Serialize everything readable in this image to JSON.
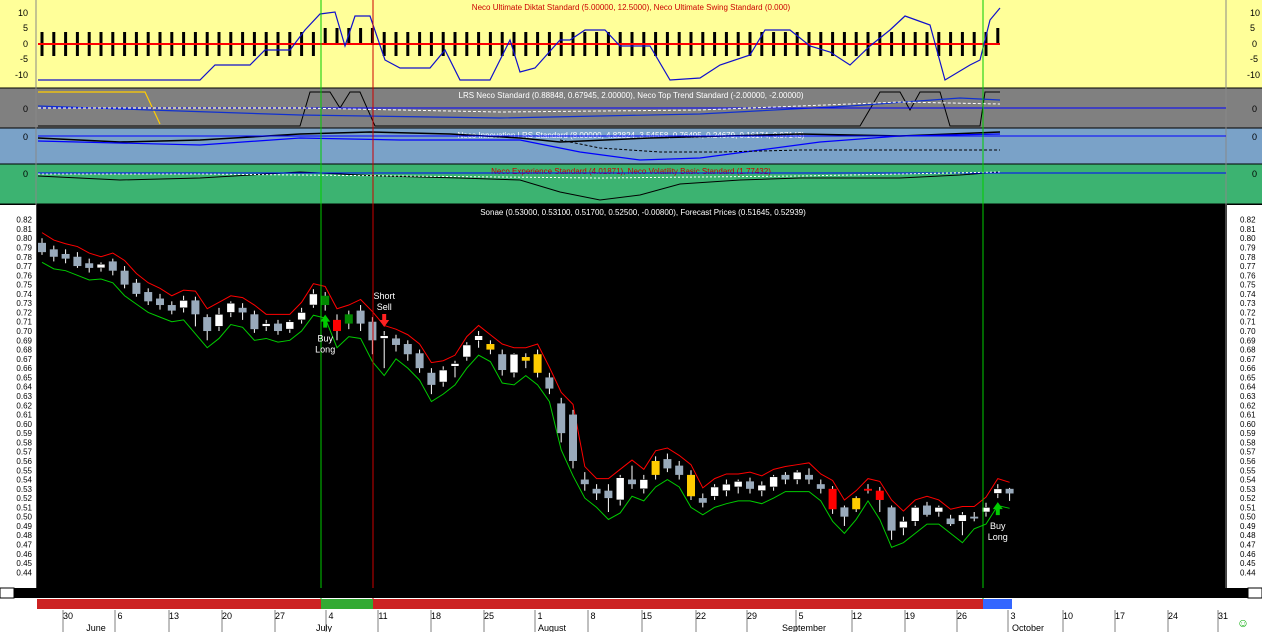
{
  "chart_data": {
    "type": "candlestick",
    "title": "Sonae (0.53000, 0.53100, 0.51700, 0.52500, -0.00800), Forecast Prices (0.51645, 0.52939)",
    "panels": [
      {
        "id": "diktat",
        "title": "Neco Ultimate Diktat Standard (5.00000, 12.5000), Neco Ultimate Swing Standard (0.000)",
        "ticks": [
          "10",
          "5",
          "0",
          "-5",
          "-10"
        ],
        "background": "#ffff99"
      },
      {
        "id": "lrs",
        "title": "LRS Neco Standard (0.88848, 0.67945, 2.00000), Neco Top Trend Standard (-2.00000, -2.00000)",
        "ticks": [
          "0"
        ],
        "background": "#808080"
      },
      {
        "id": "innovation",
        "title": "Neco Innovation LRS Standard (8.00000, 4.82824, 3.54558, 0.76495, 0.24679, 0.16174, 0.97143)",
        "ticks": [
          "0"
        ],
        "background": "#7aa2c8"
      },
      {
        "id": "experience",
        "title": "Neco Experience Standard (4.01871), Neco Volatility Basic Standard (1.77432)",
        "ticks": [
          "0"
        ],
        "background": "#3cb371"
      }
    ],
    "price_axis": {
      "ylim": [
        0.435,
        0.825
      ],
      "ticks": [
        "0.82",
        "0.81",
        "0.80",
        "0.79",
        "0.78",
        "0.77",
        "0.76",
        "0.75",
        "0.74",
        "0.73",
        "0.72",
        "0.71",
        "0.70",
        "0.69",
        "0.68",
        "0.67",
        "0.66",
        "0.65",
        "0.64",
        "0.63",
        "0.62",
        "0.61",
        "0.60",
        "0.59",
        "0.58",
        "0.57",
        "0.56",
        "0.55",
        "0.54",
        "0.53",
        "0.52",
        "0.51",
        "0.50",
        "0.49",
        "0.48",
        "0.47",
        "0.46",
        "0.45",
        "0.44"
      ]
    },
    "x_axis": {
      "day_ticks": [
        "30",
        "6",
        "13",
        "20",
        "27",
        "4",
        "11",
        "18",
        "25",
        "1",
        "8",
        "15",
        "22",
        "29",
        "5",
        "12",
        "19",
        "26",
        "3",
        "10",
        "17",
        "24",
        "31"
      ],
      "months": [
        "June",
        "July",
        "August",
        "September",
        "October"
      ]
    },
    "candles": [
      {
        "o": 0.795,
        "h": 0.8,
        "c": 0.785,
        "l": 0.782
      },
      {
        "o": 0.788,
        "h": 0.792,
        "c": 0.78,
        "l": 0.775
      },
      {
        "o": 0.783,
        "h": 0.788,
        "c": 0.778,
        "l": 0.773
      },
      {
        "o": 0.78,
        "h": 0.785,
        "c": 0.77,
        "l": 0.768
      },
      {
        "o": 0.773,
        "h": 0.778,
        "c": 0.768,
        "l": 0.763
      },
      {
        "o": 0.768,
        "h": 0.774,
        "c": 0.772,
        "l": 0.764
      },
      {
        "o": 0.775,
        "h": 0.778,
        "c": 0.765,
        "l": 0.76
      },
      {
        "o": 0.765,
        "h": 0.77,
        "c": 0.75,
        "l": 0.746
      },
      {
        "o": 0.752,
        "h": 0.756,
        "c": 0.74,
        "l": 0.737
      },
      {
        "o": 0.742,
        "h": 0.746,
        "c": 0.732,
        "l": 0.728
      },
      {
        "o": 0.735,
        "h": 0.74,
        "c": 0.728,
        "l": 0.723
      },
      {
        "o": 0.728,
        "h": 0.732,
        "c": 0.722,
        "l": 0.718
      },
      {
        "o": 0.725,
        "h": 0.738,
        "c": 0.733,
        "l": 0.72
      },
      {
        "o": 0.733,
        "h": 0.737,
        "c": 0.718,
        "l": 0.705
      },
      {
        "o": 0.715,
        "h": 0.718,
        "c": 0.7,
        "l": 0.69
      },
      {
        "o": 0.705,
        "h": 0.725,
        "c": 0.718,
        "l": 0.7
      },
      {
        "o": 0.72,
        "h": 0.732,
        "c": 0.73,
        "l": 0.715
      },
      {
        "o": 0.725,
        "h": 0.73,
        "c": 0.72,
        "l": 0.712
      },
      {
        "o": 0.718,
        "h": 0.722,
        "c": 0.702,
        "l": 0.698
      },
      {
        "o": 0.705,
        "h": 0.712,
        "c": 0.708,
        "l": 0.7
      },
      {
        "o": 0.708,
        "h": 0.712,
        "c": 0.7,
        "l": 0.696
      },
      {
        "o": 0.702,
        "h": 0.712,
        "c": 0.71,
        "l": 0.698
      },
      {
        "o": 0.712,
        "h": 0.725,
        "c": 0.72,
        "l": 0.708
      },
      {
        "o": 0.728,
        "h": 0.745,
        "c": 0.74,
        "l": 0.725
      },
      {
        "o": 0.738,
        "h": 0.742,
        "c": 0.728,
        "l": 0.722
      },
      {
        "o": 0.712,
        "h": 0.718,
        "c": 0.7,
        "l": 0.69
      },
      {
        "o": 0.708,
        "h": 0.722,
        "c": 0.718,
        "l": 0.702
      },
      {
        "o": 0.722,
        "h": 0.728,
        "c": 0.708,
        "l": 0.7
      },
      {
        "o": 0.71,
        "h": 0.715,
        "c": 0.69,
        "l": 0.675
      },
      {
        "o": 0.692,
        "h": 0.7,
        "c": 0.695,
        "l": 0.66
      },
      {
        "o": 0.692,
        "h": 0.696,
        "c": 0.685,
        "l": 0.678
      },
      {
        "o": 0.686,
        "h": 0.69,
        "c": 0.675,
        "l": 0.668
      },
      {
        "o": 0.676,
        "h": 0.68,
        "c": 0.66,
        "l": 0.655
      },
      {
        "o": 0.655,
        "h": 0.66,
        "c": 0.642,
        "l": 0.632
      },
      {
        "o": 0.645,
        "h": 0.662,
        "c": 0.658,
        "l": 0.64
      },
      {
        "o": 0.662,
        "h": 0.668,
        "c": 0.665,
        "l": 0.65
      },
      {
        "o": 0.672,
        "h": 0.688,
        "c": 0.685,
        "l": 0.668
      },
      {
        "o": 0.69,
        "h": 0.7,
        "c": 0.695,
        "l": 0.682
      },
      {
        "o": 0.686,
        "h": 0.69,
        "c": 0.68,
        "l": 0.675
      },
      {
        "o": 0.675,
        "h": 0.68,
        "c": 0.658,
        "l": 0.652
      },
      {
        "o": 0.655,
        "h": 0.676,
        "c": 0.675,
        "l": 0.65
      },
      {
        "o": 0.672,
        "h": 0.676,
        "c": 0.668,
        "l": 0.66
      },
      {
        "o": 0.675,
        "h": 0.68,
        "c": 0.655,
        "l": 0.65
      },
      {
        "o": 0.65,
        "h": 0.655,
        "c": 0.638,
        "l": 0.632
      },
      {
        "o": 0.622,
        "h": 0.628,
        "c": 0.59,
        "l": 0.58
      },
      {
        "o": 0.61,
        "h": 0.615,
        "c": 0.56,
        "l": 0.552
      },
      {
        "o": 0.54,
        "h": 0.548,
        "c": 0.535,
        "l": 0.528
      },
      {
        "o": 0.53,
        "h": 0.535,
        "c": 0.525,
        "l": 0.518
      },
      {
        "o": 0.528,
        "h": 0.535,
        "c": 0.52,
        "l": 0.505
      },
      {
        "o": 0.518,
        "h": 0.545,
        "c": 0.542,
        "l": 0.512
      },
      {
        "o": 0.54,
        "h": 0.555,
        "c": 0.535,
        "l": 0.53
      },
      {
        "o": 0.53,
        "h": 0.545,
        "c": 0.54,
        "l": 0.525
      },
      {
        "o": 0.545,
        "h": 0.565,
        "c": 0.56,
        "l": 0.54
      },
      {
        "o": 0.562,
        "h": 0.568,
        "c": 0.552,
        "l": 0.548
      },
      {
        "o": 0.555,
        "h": 0.56,
        "c": 0.545,
        "l": 0.54
      },
      {
        "o": 0.545,
        "h": 0.55,
        "c": 0.522,
        "l": 0.518
      },
      {
        "o": 0.52,
        "h": 0.525,
        "c": 0.515,
        "l": 0.51
      },
      {
        "o": 0.522,
        "h": 0.535,
        "c": 0.532,
        "l": 0.518
      },
      {
        "o": 0.528,
        "h": 0.54,
        "c": 0.535,
        "l": 0.522
      },
      {
        "o": 0.532,
        "h": 0.54,
        "c": 0.538,
        "l": 0.525
      },
      {
        "o": 0.538,
        "h": 0.542,
        "c": 0.53,
        "l": 0.525
      },
      {
        "o": 0.528,
        "h": 0.538,
        "c": 0.534,
        "l": 0.522
      },
      {
        "o": 0.532,
        "h": 0.545,
        "c": 0.543,
        "l": 0.528
      },
      {
        "o": 0.545,
        "h": 0.548,
        "c": 0.54,
        "l": 0.535
      },
      {
        "o": 0.54,
        "h": 0.55,
        "c": 0.548,
        "l": 0.535
      },
      {
        "o": 0.545,
        "h": 0.552,
        "c": 0.54,
        "l": 0.535
      },
      {
        "o": 0.535,
        "h": 0.54,
        "c": 0.53,
        "l": 0.525
      },
      {
        "o": 0.53,
        "h": 0.533,
        "c": 0.508,
        "l": 0.503
      },
      {
        "o": 0.51,
        "h": 0.512,
        "c": 0.5,
        "l": 0.49
      },
      {
        "o": 0.508,
        "h": 0.522,
        "c": 0.52,
        "l": 0.505
      },
      {
        "o": 0.53,
        "h": 0.535,
        "c": 0.528,
        "l": 0.525
      },
      {
        "o": 0.528,
        "h": 0.532,
        "c": 0.518,
        "l": 0.505
      },
      {
        "o": 0.51,
        "h": 0.512,
        "c": 0.485,
        "l": 0.475
      },
      {
        "o": 0.488,
        "h": 0.5,
        "c": 0.495,
        "l": 0.48
      },
      {
        "o": 0.495,
        "h": 0.512,
        "c": 0.51,
        "l": 0.49
      },
      {
        "o": 0.512,
        "h": 0.516,
        "c": 0.502,
        "l": 0.5
      },
      {
        "o": 0.505,
        "h": 0.512,
        "c": 0.51,
        "l": 0.5
      },
      {
        "o": 0.498,
        "h": 0.502,
        "c": 0.492,
        "l": 0.49
      },
      {
        "o": 0.495,
        "h": 0.505,
        "c": 0.502,
        "l": 0.48
      },
      {
        "o": 0.5,
        "h": 0.505,
        "c": 0.498,
        "l": 0.495
      },
      {
        "o": 0.505,
        "h": 0.515,
        "c": 0.51,
        "l": 0.5
      },
      {
        "o": 0.525,
        "h": 0.535,
        "c": 0.53,
        "l": 0.52
      },
      {
        "o": 0.53,
        "h": 0.531,
        "c": 0.525,
        "l": 0.517
      }
    ],
    "signals": [
      {
        "label": [
          "Buy",
          "Long"
        ],
        "type": "buy",
        "candle": 24
      },
      {
        "label": [
          "Short",
          "Sell"
        ],
        "type": "sell",
        "candle": 29
      },
      {
        "label": [
          "Buy",
          "Long"
        ],
        "type": "buy",
        "candle": 81
      }
    ]
  },
  "colors": {
    "bull": "#ffffff",
    "bear": "#99aabb",
    "red_fill": "#ff0000",
    "orange_fill": "#ffcc00",
    "green_fill": "#008800",
    "red_line": "#ff0000",
    "green_line": "#00cc00"
  }
}
